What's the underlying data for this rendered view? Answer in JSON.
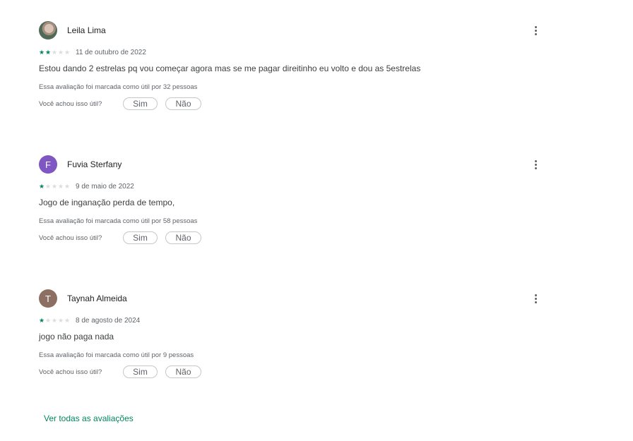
{
  "reviews": [
    {
      "name": "Leila Lima",
      "avatar_initial": "",
      "avatar_type": "photo",
      "avatar_color": "#4f6a55",
      "rating": 2,
      "date": "11 de outubro de 2022",
      "text": "Estou dando 2 estrelas pq vou começar agora mas se me pagar direitinho eu volto e dou as 5estrelas",
      "helpful_count_text": "Essa avaliação foi marcada como útil por 32 pessoas",
      "helpful_question": "Você achou isso útil?",
      "yes_label": "Sim",
      "no_label": "Não"
    },
    {
      "name": "Fuvia Sterfany",
      "avatar_initial": "F",
      "avatar_type": "letter",
      "avatar_color": "#7e57c2",
      "rating": 1,
      "date": "9 de maio de 2022",
      "text": "Jogo de inganação perda de tempo,",
      "helpful_count_text": "Essa avaliação foi marcada como útil por 58 pessoas",
      "helpful_question": "Você achou isso útil?",
      "yes_label": "Sim",
      "no_label": "Não"
    },
    {
      "name": "Taynah Almeida",
      "avatar_initial": "T",
      "avatar_type": "letter",
      "avatar_color": "#8d6e63",
      "rating": 1,
      "date": "8 de agosto de 2024",
      "text": "jogo não paga nada",
      "helpful_count_text": "Essa avaliação foi marcada como útil por 9 pessoas",
      "helpful_question": "Você achou isso útil?",
      "yes_label": "Sim",
      "no_label": "Não"
    }
  ],
  "see_all_label": "Ver todas as avaliações",
  "colors": {
    "accent": "#01875f",
    "star_off": "#dadce0"
  }
}
